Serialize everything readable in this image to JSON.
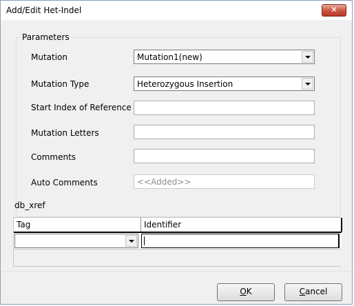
{
  "window": {
    "title": "Add/Edit Het-Indel",
    "close_icon": "close-icon"
  },
  "parameters": {
    "legend": "Parameters",
    "mutation": {
      "label": "Mutation",
      "value": "Mutation1(new)"
    },
    "mutation_type": {
      "label": "Mutation Type",
      "value": "Heterozygous Insertion"
    },
    "start_index": {
      "label": "Start Index of Reference",
      "value": ""
    },
    "mutation_letters": {
      "label": "Mutation Letters",
      "value": ""
    },
    "comments": {
      "label": "Comments",
      "value": ""
    },
    "auto_comments": {
      "label": "Auto Comments",
      "value": "<<Added>>"
    }
  },
  "db_xref": {
    "label": "db_xref",
    "columns": [
      "Tag",
      "Identifier"
    ],
    "rows": [
      {
        "tag": "",
        "identifier": ""
      }
    ]
  },
  "buttons": {
    "ok_mnemonic": "O",
    "ok_rest": "K",
    "cancel_mnemonic": "C",
    "cancel_rest": "ancel"
  }
}
